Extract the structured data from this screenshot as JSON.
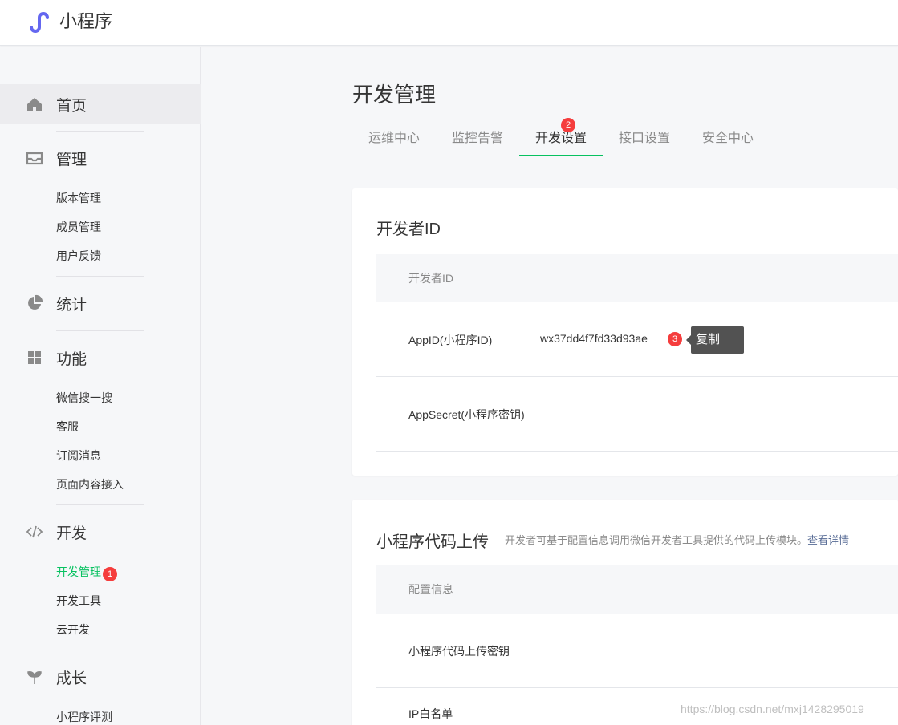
{
  "header": {
    "brand": "小程序",
    "logo_icon": "miniprogram-logo-icon"
  },
  "sidebar": {
    "home": "首页",
    "manage": {
      "label": "管理",
      "items": [
        "版本管理",
        "成员管理",
        "用户反馈"
      ]
    },
    "stats": "统计",
    "features": {
      "label": "功能",
      "items": [
        "微信搜一搜",
        "客服",
        "订阅消息",
        "页面内容接入"
      ]
    },
    "dev": {
      "label": "开发",
      "items": [
        "开发管理",
        "开发工具",
        "云开发"
      ],
      "active_badge": "1"
    },
    "growth": {
      "label": "成长",
      "items": [
        "小程序评测"
      ]
    }
  },
  "main": {
    "title": "开发管理",
    "tabs": [
      "运维中心",
      "监控告警",
      "开发设置",
      "接口设置",
      "安全中心"
    ],
    "tab_badge": "2",
    "developer_card": {
      "title": "开发者ID",
      "head": "开发者ID",
      "appid_label": "AppID(小程序ID)",
      "appid_value": "wx37dd4f7fd33d93ae",
      "appid_badge": "3",
      "copy_tooltip": "复制",
      "secret_label": "AppSecret(小程序密钥)"
    },
    "upload_card": {
      "title": "小程序代码上传",
      "desc": "开发者可基于配置信息调用微信开发者工具提供的代码上传模块。",
      "link": "查看详情",
      "head": "配置信息",
      "key_label": "小程序代码上传密钥",
      "ip_label": "IP白名单"
    }
  },
  "watermark": "https://blog.csdn.net/mxj1428295019",
  "colors": {
    "accent": "#07c160",
    "badge": "#f53d3d",
    "link": "#576b95",
    "logo": "#6467f0"
  }
}
